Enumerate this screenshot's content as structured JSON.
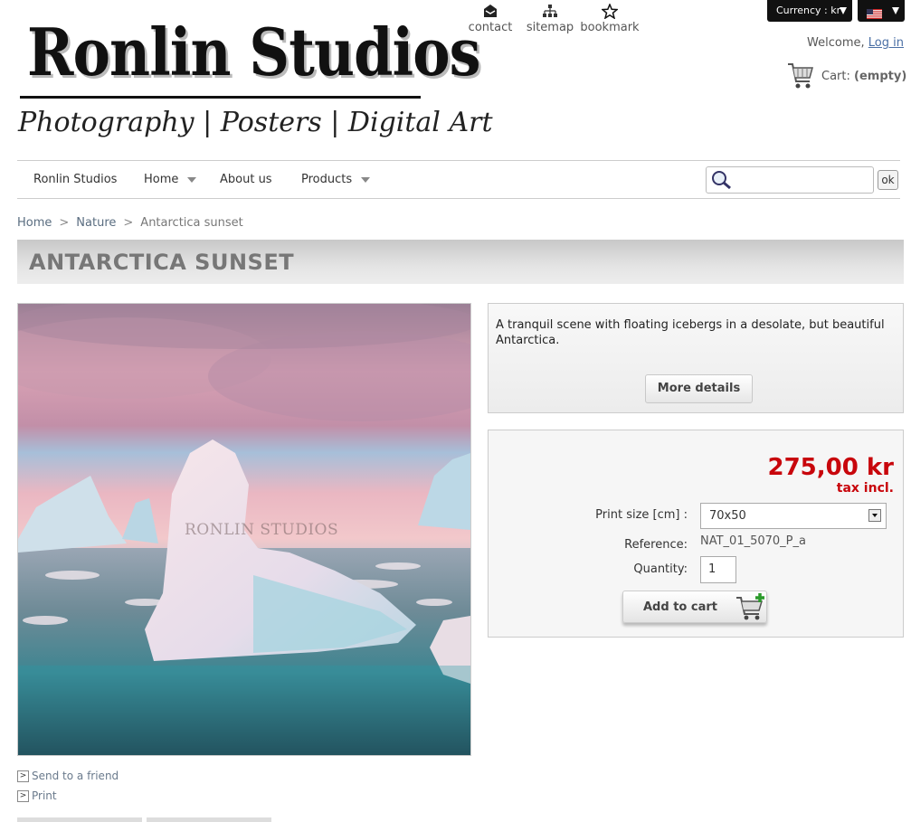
{
  "logo": {
    "title": "Ronlin Studios",
    "subtitle": "Photography | Posters | Digital Art"
  },
  "top_links": [
    {
      "label": "contact",
      "icon": "envelope-icon"
    },
    {
      "label": "sitemap",
      "icon": "sitemap-icon"
    },
    {
      "label": "bookmark",
      "icon": "star-icon"
    }
  ],
  "header": {
    "currency_label": "Currency : kr",
    "language_icon": "us-flag-icon",
    "welcome_text": "Welcome,",
    "login_label": "Log in",
    "cart_label": "Cart:",
    "cart_status": "(empty)"
  },
  "nav": {
    "items": [
      {
        "label": "Ronlin Studios",
        "has_dropdown": false
      },
      {
        "label": "Home",
        "has_dropdown": true
      },
      {
        "label": "About us",
        "has_dropdown": false
      },
      {
        "label": "Products",
        "has_dropdown": true
      }
    ],
    "search_placeholder": "",
    "search_button": "ok"
  },
  "breadcrumb": {
    "items": [
      "Home",
      "Nature",
      "Antarctica sunset"
    ],
    "separator": ">"
  },
  "product": {
    "title": "ANTARCTICA SUNSET",
    "image_watermark": "RONLIN STUDIOS",
    "description": "A tranquil scene with floating icebergs in a desolate, but beautiful Antarctica.",
    "more_details_label": "More details",
    "price": "275,00 kr",
    "tax_label": "tax incl.",
    "print_size_label": "Print size [cm] :",
    "print_size_value": "70x50",
    "reference_label": "Reference:",
    "reference_value": "NAT_01_5070_P_a",
    "quantity_label": "Quantity:",
    "quantity_value": "1",
    "add_to_cart_label": "Add to cart"
  },
  "side_links": [
    {
      "label": "Send to a friend"
    },
    {
      "label": "Print"
    }
  ],
  "colors": {
    "price": "#c8060c",
    "link": "#4a6fa5",
    "title_bar": "#d6d6d6"
  }
}
